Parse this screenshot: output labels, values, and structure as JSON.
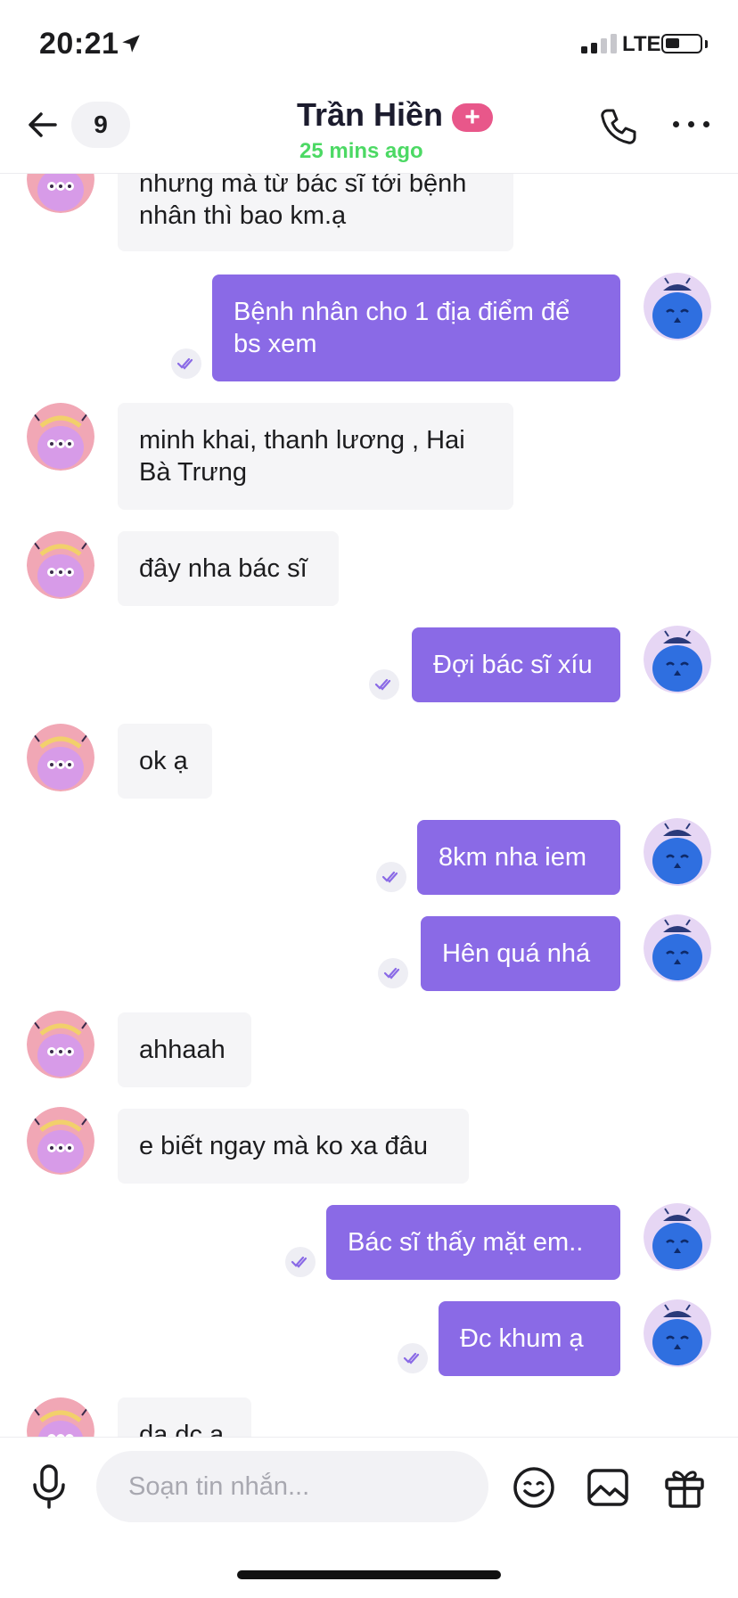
{
  "status_bar": {
    "time": "20:21",
    "network": "LTE",
    "signal_bars": 2,
    "battery_level": 0.35
  },
  "header": {
    "back_icon": "arrow-left-icon",
    "unread_count": "9",
    "contact_name": "Trần Hiền",
    "badge_icon": "plus-icon",
    "badge_color": "#e8578a",
    "last_seen": "25 mins ago",
    "last_seen_color": "#4cd964",
    "call_icon": "phone-icon",
    "more_icon": "more-horizontal-icon"
  },
  "messages": [
    {
      "sender": "contact",
      "text": "nhưng mà từ bác sĩ tới bệnh nhân thì bao km.ạ"
    },
    {
      "sender": "me",
      "text": "Bệnh nhân cho 1 địa điểm để bs xem",
      "status_icon": "double-check-icon"
    },
    {
      "sender": "contact",
      "text": "minh khai, thanh lương , Hai Bà Trưng"
    },
    {
      "sender": "contact",
      "text": "đây nha bác sĩ"
    },
    {
      "sender": "me",
      "text": "Đợi bác sĩ xíu",
      "status_icon": "double-check-icon"
    },
    {
      "sender": "contact",
      "text": "ok ạ"
    },
    {
      "sender": "me",
      "text": "8km nha iem",
      "status_icon": "double-check-icon"
    },
    {
      "sender": "me",
      "text": "Hên quá nhá",
      "status_icon": "double-check-icon"
    },
    {
      "sender": "contact",
      "text": "ahhaah"
    },
    {
      "sender": "contact",
      "text": "e biết ngay mà ko xa đâu"
    },
    {
      "sender": "me",
      "text": "Bác sĩ thấy mặt em..",
      "status_icon": "double-check-icon"
    },
    {
      "sender": "me",
      "text": "Đc khum ạ",
      "status_icon": "double-check-icon"
    },
    {
      "sender": "contact",
      "text": "dạ dc ạ"
    }
  ],
  "composer": {
    "placeholder": "Soạn tin nhắn...",
    "value": "",
    "mic_icon": "microphone-icon",
    "emoji_icon": "smiley-icon",
    "image_icon": "image-icon",
    "gift_icon": "gift-icon"
  },
  "colors": {
    "outgoing_bubble": "#8a6ae6",
    "incoming_bubble": "#f5f5f7",
    "accent": "#8a6ae6"
  }
}
